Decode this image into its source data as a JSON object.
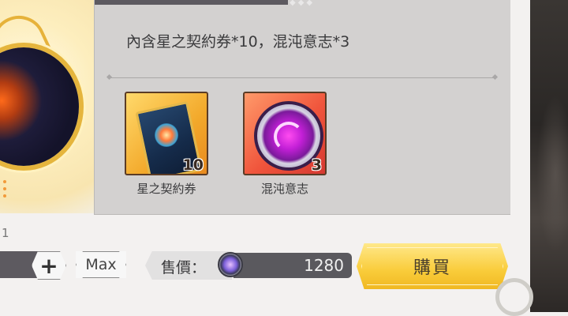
{
  "panel": {
    "description": "內含星之契約券*10，混沌意志*3"
  },
  "items": [
    {
      "label": "星之契約券",
      "quantity": "10",
      "icon": "contract-ticket-icon"
    },
    {
      "label": "混沌意志",
      "quantity": "3",
      "icon": "chaos-will-orb-icon"
    }
  ],
  "stray_text": "1",
  "controls": {
    "plus_label": "+",
    "max_label": "Max"
  },
  "price": {
    "label": "售價：",
    "value": "1280",
    "currency_icon": "gem-coin-icon"
  },
  "buy_label": "購買",
  "colors": {
    "panel_bg": "#d3d1d0",
    "buy_button": "#f9cc3a",
    "price_box": "#5a595e"
  }
}
